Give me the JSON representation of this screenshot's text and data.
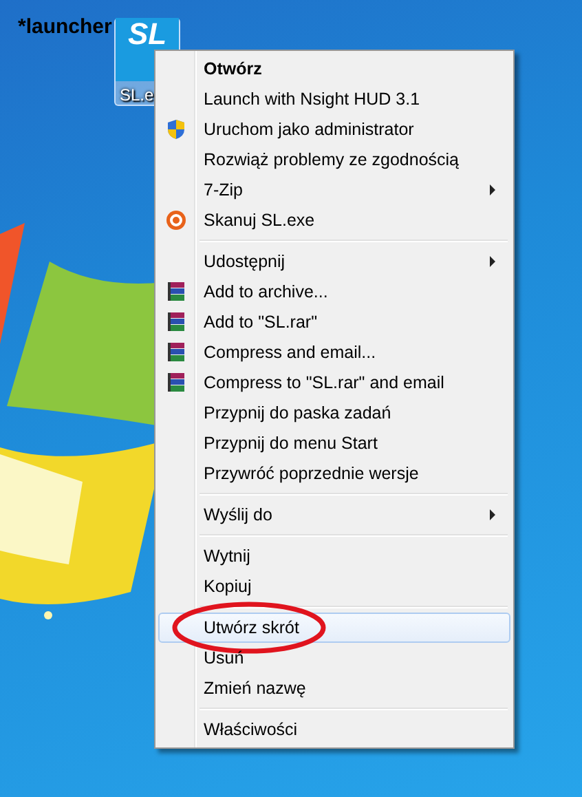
{
  "desktop": {
    "caption": "*launcher",
    "icon": {
      "logo": "SL",
      "label": "SL.e",
      "selected": true
    }
  },
  "menu": {
    "groups": [
      {
        "items": [
          {
            "label": "Otwórz",
            "kind": "plain",
            "default": true,
            "submenu": false,
            "selected": false,
            "circled": false
          },
          {
            "label": "Launch with Nsight HUD 3.1",
            "kind": "plain",
            "default": false,
            "submenu": false,
            "selected": false,
            "circled": false
          },
          {
            "label": "Uruchom jako administrator",
            "kind": "shield",
            "default": false,
            "submenu": false,
            "selected": false,
            "circled": false
          },
          {
            "label": "Rozwiąż problemy ze zgodnością",
            "kind": "plain",
            "default": false,
            "submenu": false,
            "selected": false,
            "circled": false
          },
          {
            "label": "7-Zip",
            "kind": "plain",
            "default": false,
            "submenu": true,
            "selected": false,
            "circled": false
          },
          {
            "label": "Skanuj SL.exe",
            "kind": "scan",
            "default": false,
            "submenu": false,
            "selected": false,
            "circled": false
          }
        ]
      },
      {
        "items": [
          {
            "label": "Udostępnij",
            "kind": "plain",
            "default": false,
            "submenu": true,
            "selected": false,
            "circled": false
          },
          {
            "label": "Add to archive...",
            "kind": "archive",
            "default": false,
            "submenu": false,
            "selected": false,
            "circled": false
          },
          {
            "label": "Add to \"SL.rar\"",
            "kind": "archive",
            "default": false,
            "submenu": false,
            "selected": false,
            "circled": false
          },
          {
            "label": "Compress and email...",
            "kind": "archive",
            "default": false,
            "submenu": false,
            "selected": false,
            "circled": false
          },
          {
            "label": "Compress to \"SL.rar\" and email",
            "kind": "archive",
            "default": false,
            "submenu": false,
            "selected": false,
            "circled": false
          },
          {
            "label": "Przypnij do paska zadań",
            "kind": "plain",
            "default": false,
            "submenu": false,
            "selected": false,
            "circled": false
          },
          {
            "label": "Przypnij do menu Start",
            "kind": "plain",
            "default": false,
            "submenu": false,
            "selected": false,
            "circled": false
          },
          {
            "label": "Przywróć poprzednie wersje",
            "kind": "plain",
            "default": false,
            "submenu": false,
            "selected": false,
            "circled": false
          }
        ]
      },
      {
        "items": [
          {
            "label": "Wyślij do",
            "kind": "plain",
            "default": false,
            "submenu": true,
            "selected": false,
            "circled": false
          }
        ]
      },
      {
        "items": [
          {
            "label": "Wytnij",
            "kind": "plain",
            "default": false,
            "submenu": false,
            "selected": false,
            "circled": false
          },
          {
            "label": "Kopiuj",
            "kind": "plain",
            "default": false,
            "submenu": false,
            "selected": false,
            "circled": false
          }
        ]
      },
      {
        "items": [
          {
            "label": "Utwórz skrót",
            "kind": "plain",
            "default": false,
            "submenu": false,
            "selected": true,
            "circled": true
          },
          {
            "label": "Usuń",
            "kind": "plain",
            "default": false,
            "submenu": false,
            "selected": false,
            "circled": false
          },
          {
            "label": "Zmień nazwę",
            "kind": "plain",
            "default": false,
            "submenu": false,
            "selected": false,
            "circled": false
          }
        ]
      },
      {
        "items": [
          {
            "label": "Właściwości",
            "kind": "plain",
            "default": false,
            "submenu": false,
            "selected": false,
            "circled": false
          }
        ]
      }
    ]
  }
}
